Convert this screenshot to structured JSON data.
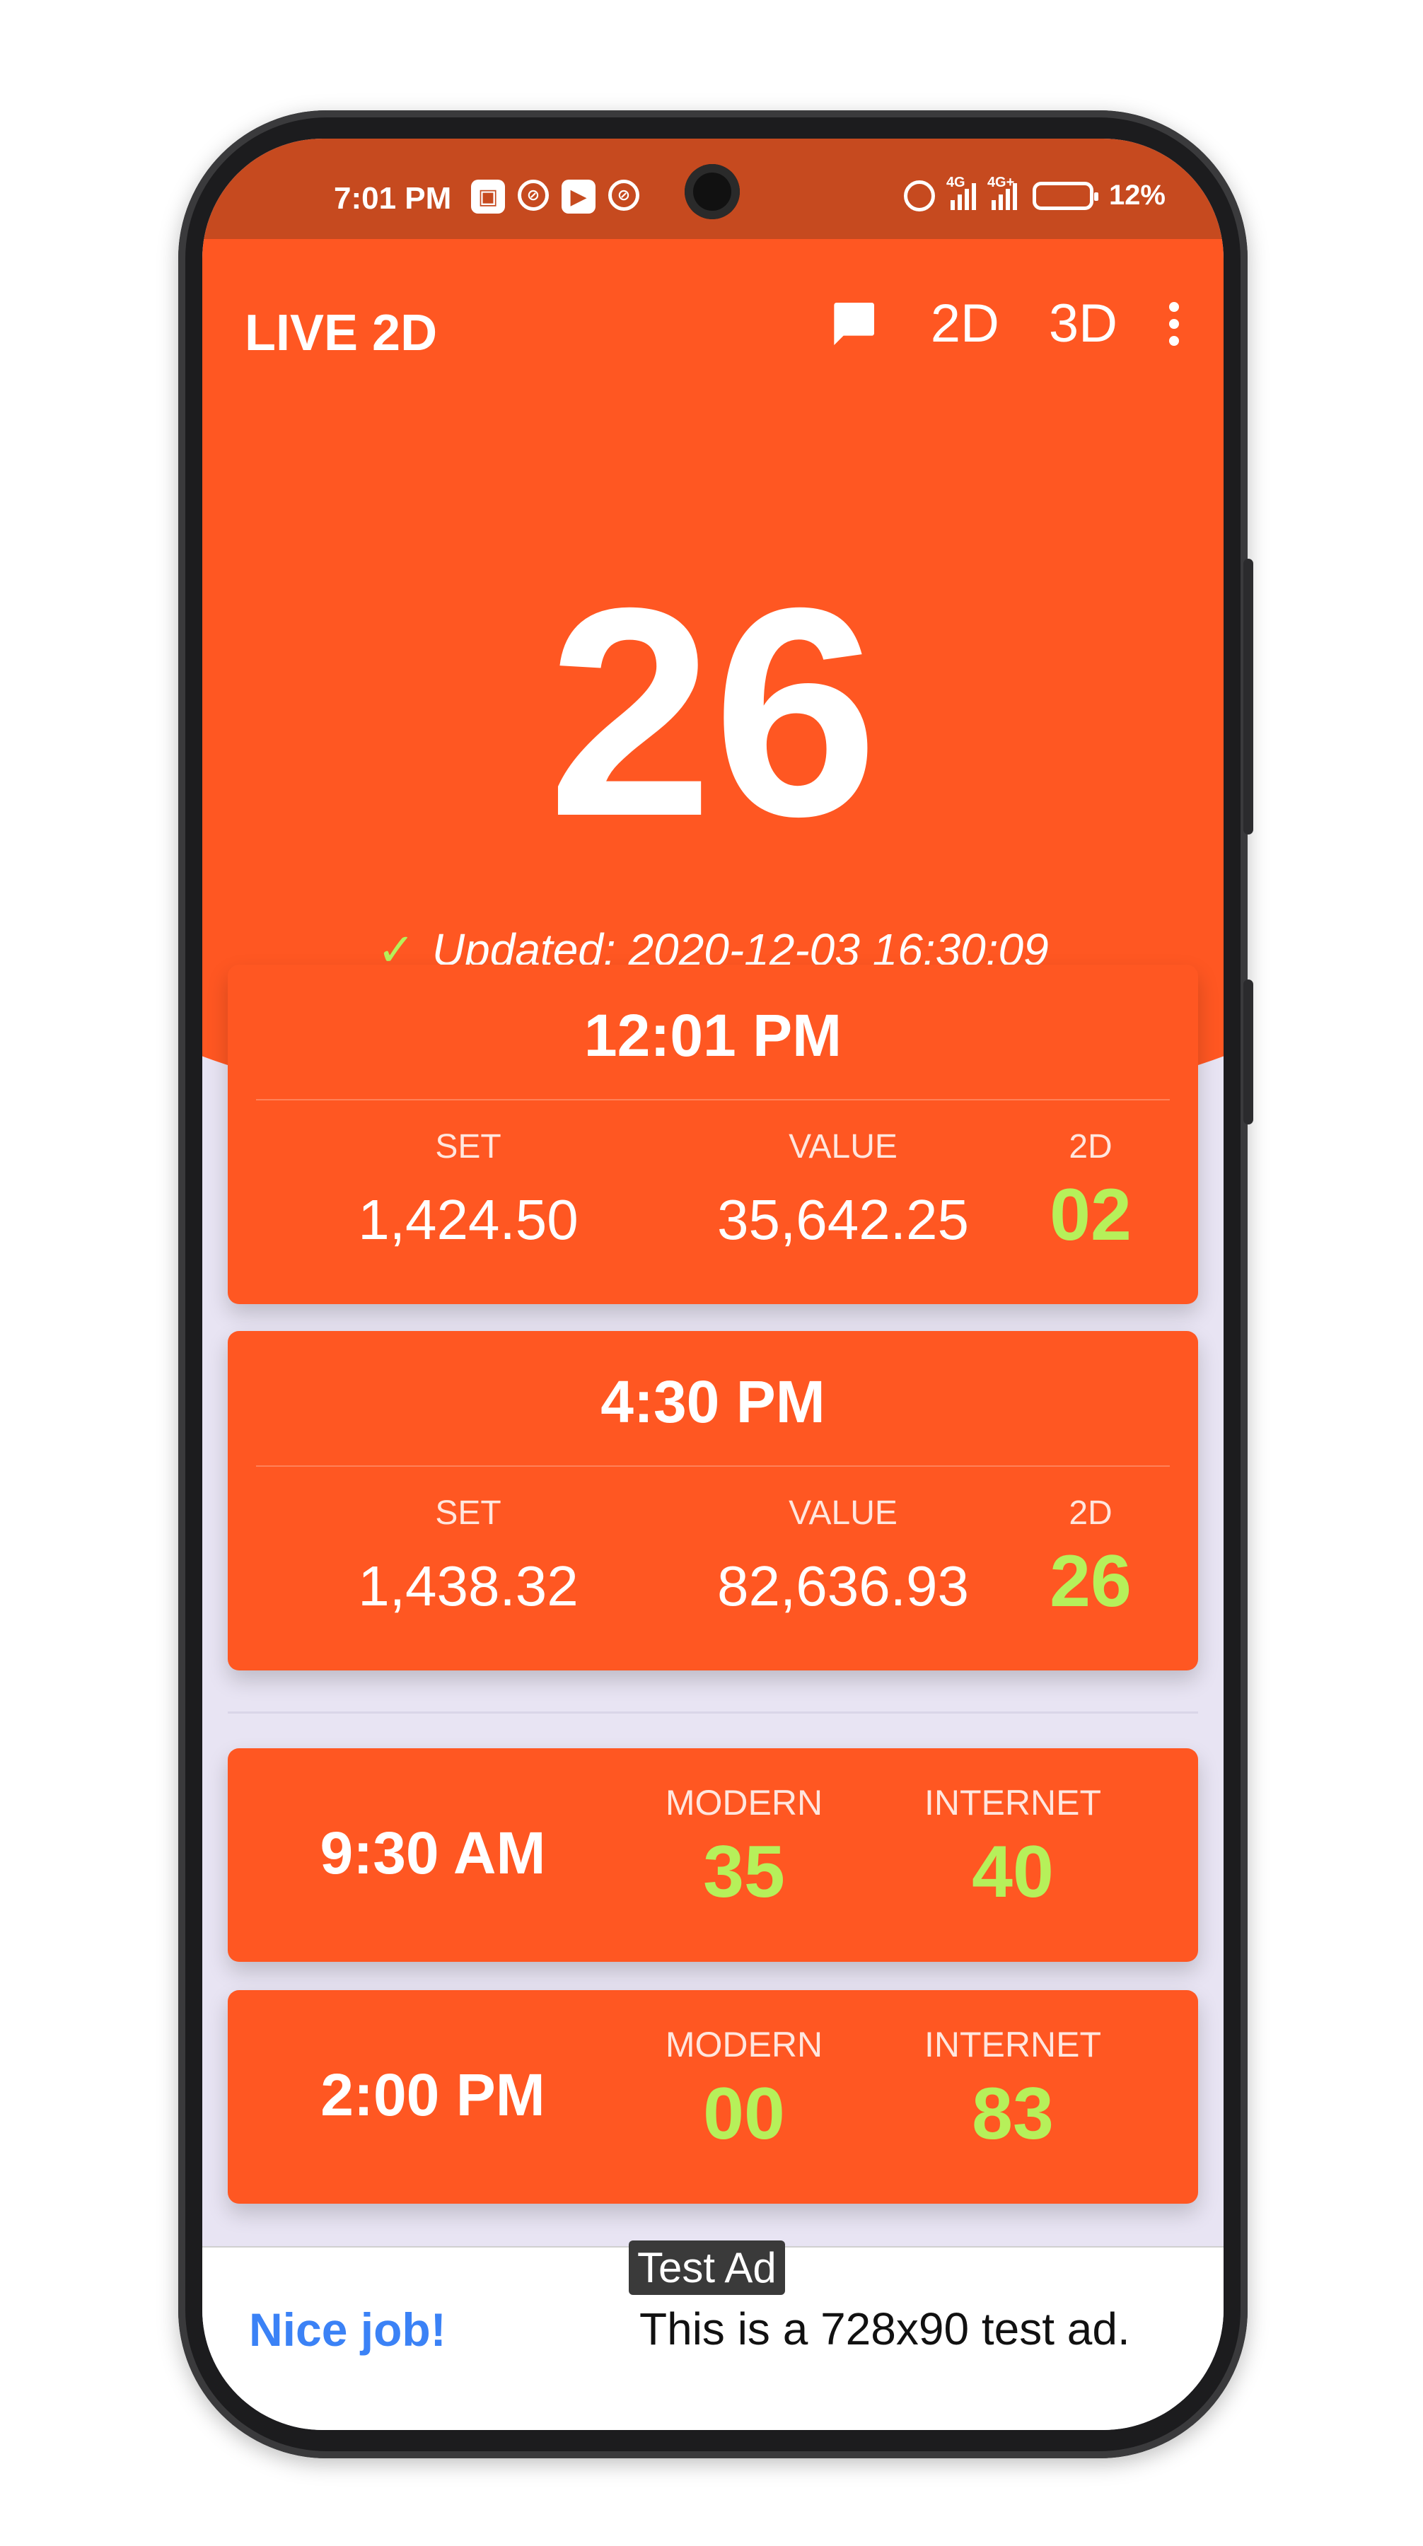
{
  "status_bar": {
    "time": "7:01 PM",
    "left_icons": [
      "mi-store-icon",
      "vpn-icon",
      "play-store-icon",
      "vpn-icon"
    ],
    "right_icons": [
      "alarm-icon",
      "signal-4g-icon",
      "signal-4g-plus-icon",
      "battery-charging-icon"
    ],
    "network_1": "4G",
    "network_2": "4G+",
    "battery": "12%"
  },
  "toolbar": {
    "title": "LIVE 2D",
    "btn_2d": "2D",
    "btn_3d": "3D",
    "icons": [
      "chat-icon",
      "more-vert-icon"
    ]
  },
  "live": {
    "number": "26",
    "updated": "Updated: 2020-12-03 16:30:09",
    "check_icon": "check-icon"
  },
  "results": [
    {
      "time": "12:01 PM",
      "set_label": "SET",
      "set": "1,424.50",
      "value_label": "VALUE",
      "value": "35,642.25",
      "d_label": "2D",
      "d": "02"
    },
    {
      "time": "4:30 PM",
      "set_label": "SET",
      "set": "1,438.32",
      "value_label": "VALUE",
      "value": "82,636.93",
      "d_label": "2D",
      "d": "26"
    }
  ],
  "sessions": [
    {
      "time": "9:30 AM",
      "modern_label": "MODERN",
      "modern": "35",
      "internet_label": "INTERNET",
      "internet": "40"
    },
    {
      "time": "2:00 PM",
      "modern_label": "MODERN",
      "modern": "00",
      "internet_label": "INTERNET",
      "internet": "83"
    }
  ],
  "ad": {
    "badge": "Test Ad",
    "nice": "Nice job!",
    "text": "This is a 728x90 test ad."
  },
  "colors": {
    "primary": "#ff5722",
    "status_bar": "#c64a1f",
    "accent_green": "#b6f05a",
    "background": "#e8e4f3"
  }
}
